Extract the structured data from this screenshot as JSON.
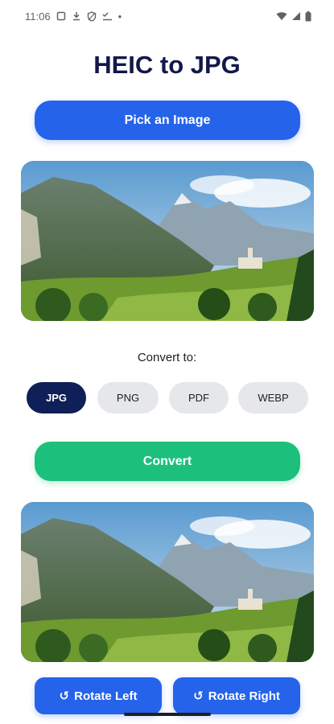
{
  "status_bar": {
    "time": "11:06",
    "left_icons": [
      "screen-record-icon",
      "download-icon",
      "shield-icon",
      "checklist-icon"
    ],
    "dot": "•",
    "right_icons": [
      "wifi-icon",
      "signal-icon",
      "battery-icon"
    ]
  },
  "app": {
    "title": "HEIC to JPG",
    "pick_button": "Pick an Image",
    "convert_to_label": "Convert to:",
    "formats": [
      {
        "label": "JPG",
        "selected": true
      },
      {
        "label": "PNG",
        "selected": false
      },
      {
        "label": "PDF",
        "selected": false
      },
      {
        "label": "WEBP",
        "selected": false
      }
    ],
    "convert_button": "Convert",
    "rotate_left": "Rotate Left",
    "rotate_right": "Rotate Right",
    "rotate_icon_glyph": "↺"
  },
  "colors": {
    "primary": "#2563eb",
    "convert": "#1dbf7d",
    "chip_active": "#0f1f57",
    "chip_inactive": "#e6e7eb",
    "title": "#13184a"
  }
}
